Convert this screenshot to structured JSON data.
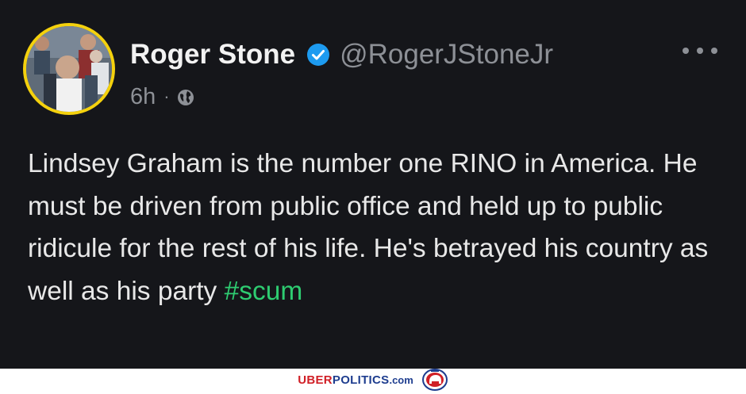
{
  "post": {
    "author": {
      "display_name": "Roger Stone",
      "handle": "@RogerJStoneJr",
      "verified": true,
      "avatar_icon": "profile-photo-avatar"
    },
    "timestamp": "6h",
    "separator": "·",
    "visibility_icon": "globe-icon",
    "more_icon": "more-options-icon",
    "text": "Lindsey Graham is the number one RINO in America. He must be driven from public office and held up to public ridicule for the rest of his life. He's betrayed his country as well as his party ",
    "hashtag": "#scum"
  },
  "watermark": {
    "part1": "UBER",
    "part2": "POLITICS",
    "part3": ".com",
    "logo_icon": "republican-elephant-logo"
  },
  "colors": {
    "background": "#15161a",
    "text": "#e8e8e8",
    "secondary": "#8d9096",
    "verified_badge": "#1d9bf0",
    "hashtag": "#2ecc71",
    "avatar_ring": "#f4d10d",
    "watermark_red": "#d01f26",
    "watermark_blue": "#1e3d8f"
  }
}
